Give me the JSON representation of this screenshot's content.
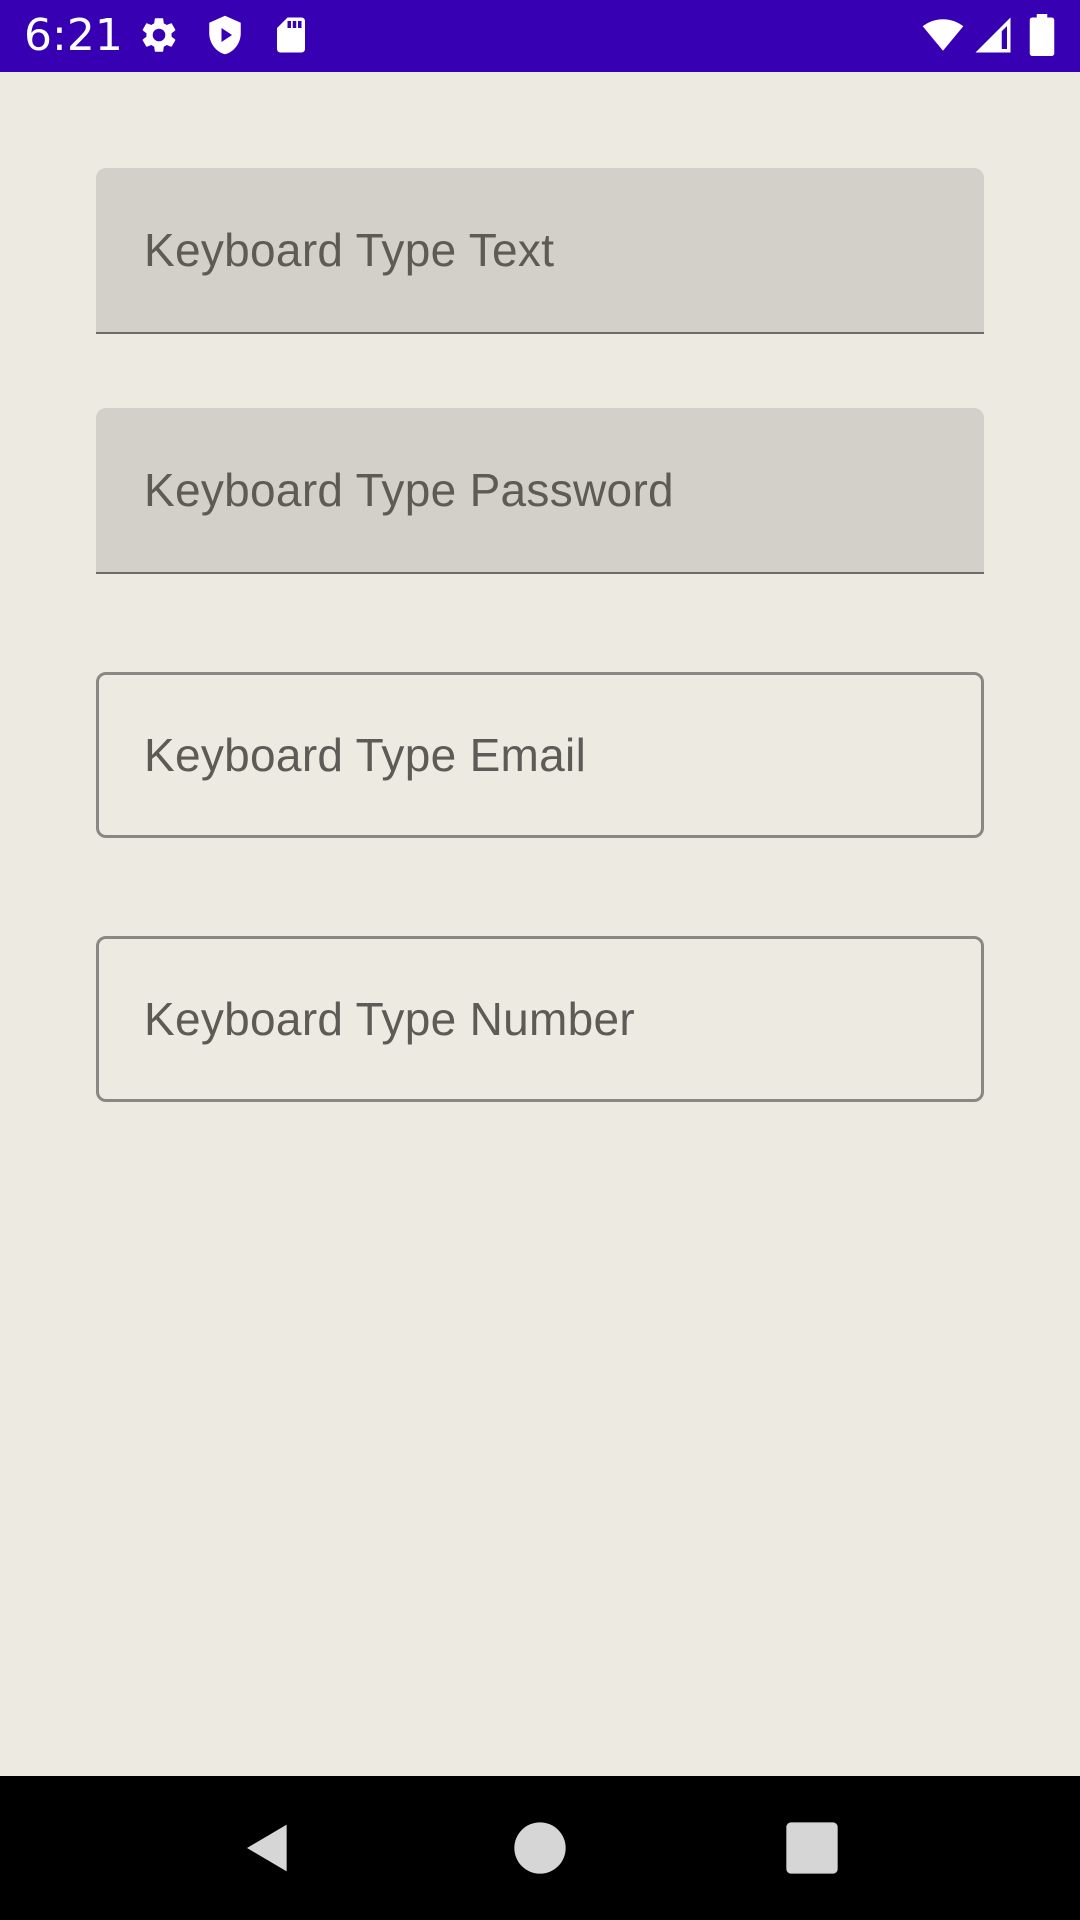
{
  "status_bar": {
    "time": "6:21",
    "background_color": "#3700b3",
    "left_icons": [
      "gear-icon",
      "play-shield-icon",
      "sd-card-icon"
    ],
    "right_icons": [
      "wifi-icon",
      "cell-signal-icon",
      "battery-icon"
    ]
  },
  "form": {
    "fields": [
      {
        "style": "filled",
        "label": "Keyboard Type Text"
      },
      {
        "style": "filled",
        "label": "Keyboard Type Password"
      },
      {
        "style": "outlined",
        "label": "Keyboard Type Email"
      },
      {
        "style": "outlined",
        "label": "Keyboard Type Number"
      }
    ]
  },
  "nav_bar": {
    "buttons": [
      "back-icon",
      "home-icon",
      "recents-icon"
    ]
  },
  "colors": {
    "background": "#edebe1",
    "filled_field": "#d2d0c8",
    "label_text": "#5c5b56"
  }
}
